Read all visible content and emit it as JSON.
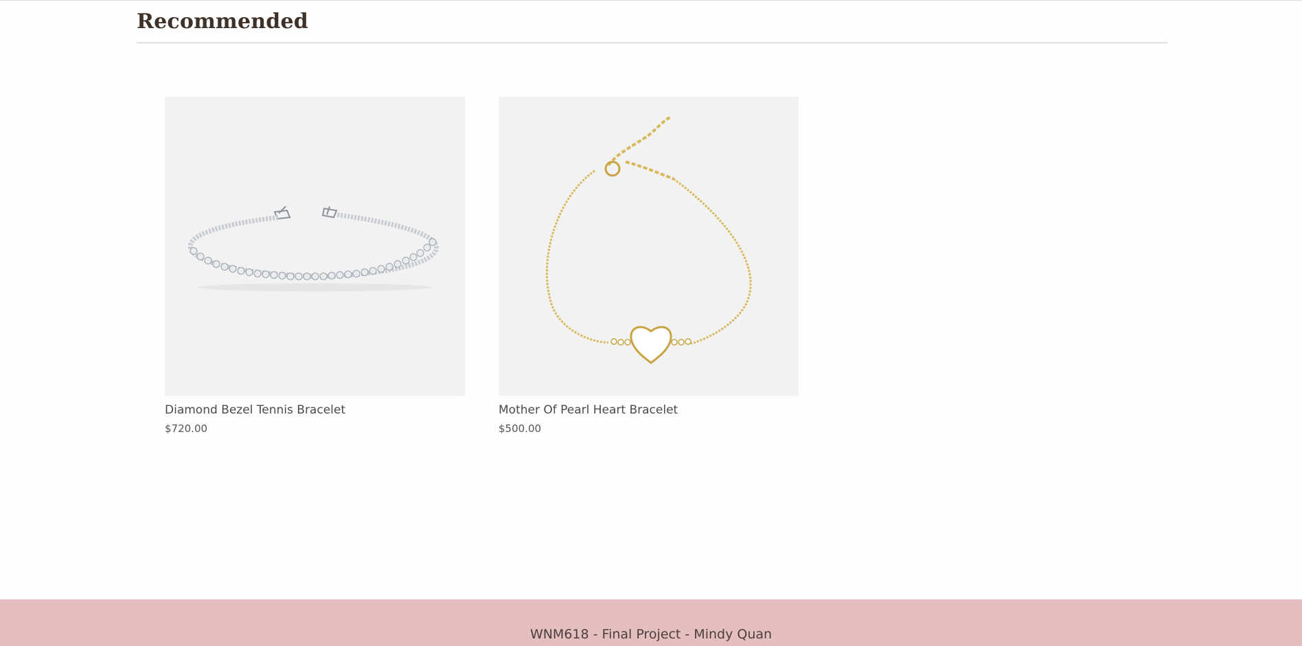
{
  "section": {
    "title": "Recommended"
  },
  "products": [
    {
      "name": "Diamond Bezel Tennis Bracelet",
      "price": "$720.00",
      "image_icon": "silver-tennis-bracelet-image"
    },
    {
      "name": "Mother Of Pearl Heart Bracelet",
      "price": "$500.00",
      "image_icon": "gold-heart-bracelet-image"
    }
  ],
  "footer": {
    "text": "WNM618 - Final Project - Mindy Quan"
  },
  "colors": {
    "footer_bg": "#e5bfc0",
    "image_bg": "#f2f2f2",
    "title_color": "#3e3128",
    "silver": "#c8ccd2",
    "gold": "#d8b85a"
  }
}
